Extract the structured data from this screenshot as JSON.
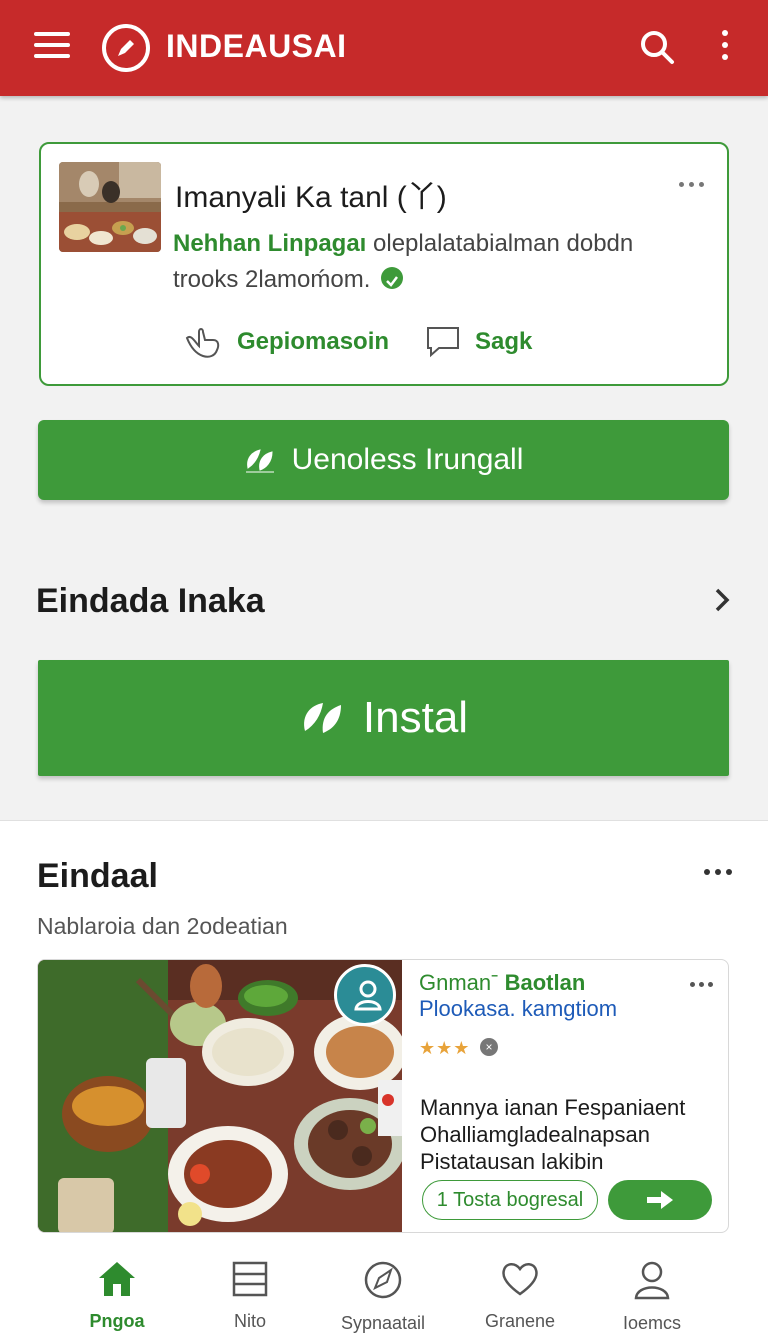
{
  "app": {
    "title": "INDEAUSAI"
  },
  "icons": {
    "menu": "hamburger-icon",
    "logo": "pencil-circle-icon",
    "search": "search-icon",
    "more": "more-vert-icon"
  },
  "colors": {
    "brand_red": "#c62a2a",
    "accent_green": "#3e9a3a",
    "link_blue": "#1e5bb8"
  },
  "review_card": {
    "heading": "Imanyali Ka tanl (丫)",
    "highlight": "Nehhan Linpagaı",
    "description": "oleplalatabialman dobdn trooks 2lamoḿom.",
    "action1": "Gepiomasoin",
    "action2": "Sagk"
  },
  "primary_button": {
    "label": "Uenoless Irungall"
  },
  "section": {
    "title": "Eindada Inaka"
  },
  "install_button": {
    "label": "Instal"
  },
  "panel": {
    "title": "Eindaal",
    "subtitle": "Nablaroia dan 2odeatian",
    "listing": {
      "line1_prefix": "Gnmanˉ",
      "line1_bold": "Baotlan",
      "line2": "Plookasa. kamgtiom",
      "stars": "★★★",
      "rating_value": 3,
      "badge": "×",
      "description": "Mannya ianan Fespaniaent Ohalliamgladealnapsan Pistatausan lakibin",
      "pill": "1 Tosta bogresal"
    }
  },
  "nav": [
    {
      "label": "Pngoa",
      "icon": "home-icon",
      "active": true
    },
    {
      "label": "Nito",
      "icon": "list-icon",
      "active": false
    },
    {
      "label": "Sypnaatail",
      "icon": "compass-icon",
      "active": false
    },
    {
      "label": "Granene",
      "icon": "heart-icon",
      "active": false
    },
    {
      "label": "Ioemcs",
      "icon": "person-icon",
      "active": false
    }
  ]
}
